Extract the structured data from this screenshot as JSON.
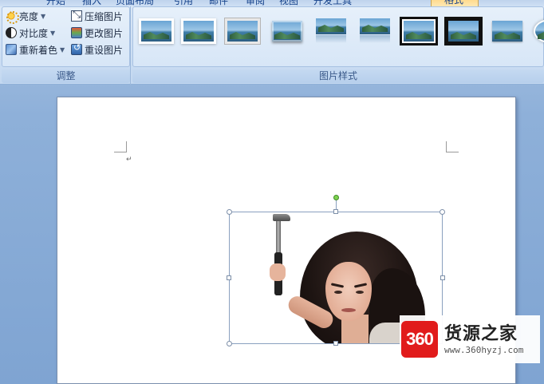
{
  "ribbon": {
    "tabs": [
      {
        "label": "开始"
      },
      {
        "label": "插入"
      },
      {
        "label": "页面布局"
      },
      {
        "label": "引用"
      },
      {
        "label": "邮件"
      },
      {
        "label": "审阅"
      },
      {
        "label": "视图"
      },
      {
        "label": "开发工具"
      },
      {
        "label": "格式",
        "active": true
      }
    ],
    "adjust_group": {
      "caption": "调整",
      "brightness": "亮度",
      "contrast": "对比度",
      "recolor": "重新着色",
      "compress": "压缩图片",
      "change_picture": "更改图片",
      "reset_picture": "重设图片"
    },
    "styles_group": {
      "caption": "图片样式",
      "styles": [
        "simple-frame-white",
        "soft-edge",
        "metal-frame",
        "beveled",
        "reflected",
        "soft-reflection",
        "double-frame-black",
        "thick-black-frame",
        "simple-shadow",
        "oval"
      ]
    }
  },
  "document": {
    "paragraph_mark": "↵"
  },
  "watermark": {
    "logo_text": "360",
    "title": "货源之家",
    "url": "www.360hyzj.com"
  },
  "colors": {
    "ribbon_bg": "#cfe0f4",
    "workspace_bg": "#8eb0d9",
    "selection_border": "#8aa0bf",
    "rotate_handle": "#7ed24f",
    "watermark_red": "#e11b1b"
  }
}
